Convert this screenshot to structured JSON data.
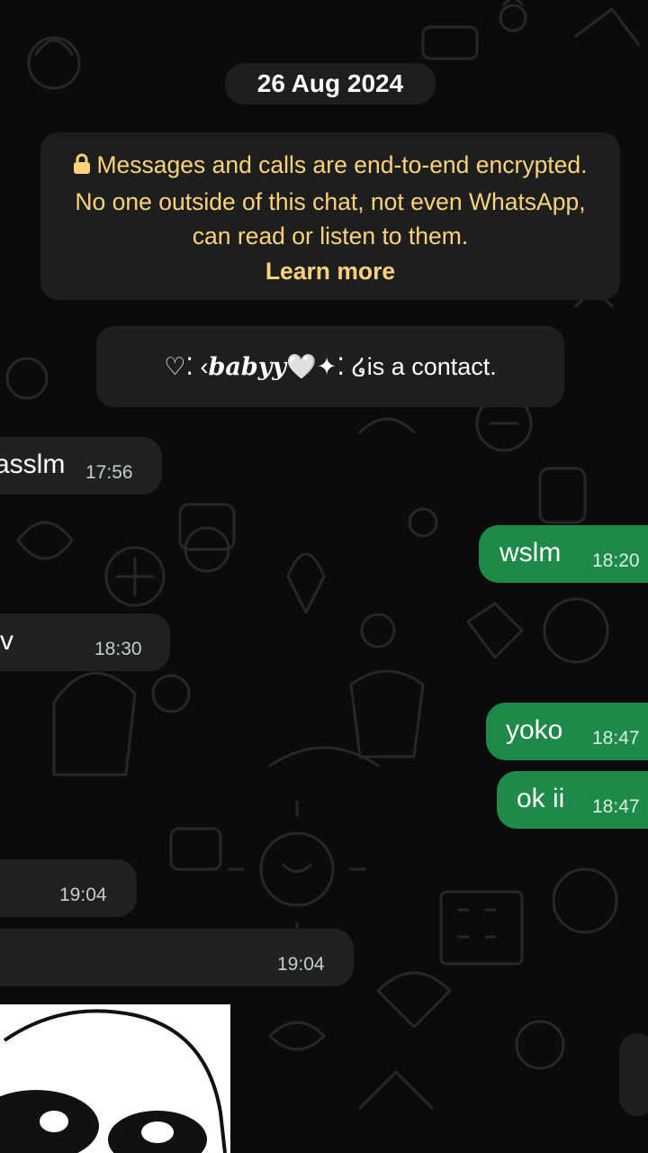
{
  "date_separator": "26 Aug 2024",
  "encryption_notice": {
    "text": "Messages and calls are end-to-end encrypted. No one outside of this chat, not even WhatsApp, can read or listen to them.",
    "link": "Learn more",
    "icon": "lock-icon"
  },
  "contact_notice": {
    "prefix": "♡⁚ ‹ ",
    "name": "babyy",
    "suffix": "🤍✦⁚ ໒ ",
    "text": "is a contact."
  },
  "messages": [
    {
      "direction": "in",
      "text": "asslm",
      "time": "17:56"
    },
    {
      "direction": "out",
      "text": "wslm",
      "time": "18:20"
    },
    {
      "direction": "in",
      "text": "v",
      "time": "18:30"
    },
    {
      "direction": "out",
      "text": "yoko",
      "time": "18:47"
    },
    {
      "direction": "out",
      "text": "ok ii",
      "time": "18:47"
    },
    {
      "direction": "in",
      "text": "",
      "time": "19:04"
    },
    {
      "direction": "in",
      "text": "",
      "time": "19:04"
    }
  ],
  "colors": {
    "background": "#0b0b0b",
    "incoming_bubble": "#1f2122",
    "outgoing_bubble": "#1d8a4a",
    "system_text": "#ffd279"
  }
}
